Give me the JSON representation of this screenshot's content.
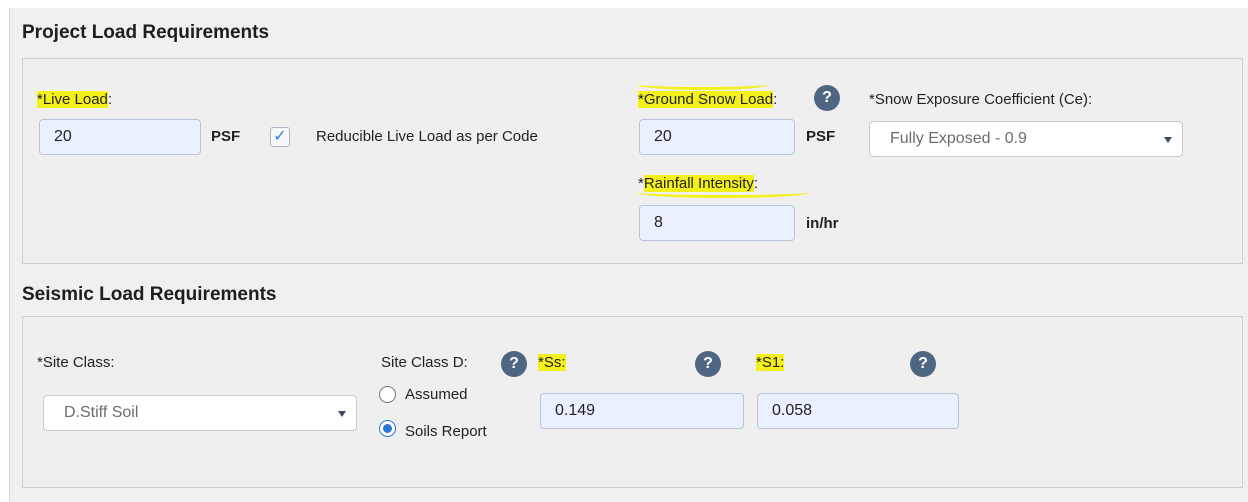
{
  "project": {
    "title": "Project Load Requirements",
    "live_load": {
      "label_prefix": "*",
      "label_hl": "Live Load",
      "label_suffix": ":",
      "value": "20",
      "unit": "PSF"
    },
    "reducible": {
      "label": "Reducible Live Load as per Code",
      "checked": true,
      "check_glyph": "✓"
    },
    "ground_snow": {
      "label_hl": "*Ground Snow Load",
      "label_suffix": ":",
      "value": "20",
      "unit": "PSF",
      "help": "?"
    },
    "snow_exposure": {
      "label": "*Snow Exposure Coefficient (Ce):",
      "selected": "Fully Exposed - 0.9"
    },
    "rainfall": {
      "label_prefix": "*",
      "label_hl": "Rainfall Intensity",
      "label_suffix": ":",
      "value": "8",
      "unit": "in/hr"
    }
  },
  "seismic": {
    "title": "Seismic Load Requirements",
    "site_class": {
      "label": "*Site Class:",
      "selected": "D.Stiff Soil"
    },
    "site_class_d": {
      "label": "Site Class D:",
      "help": "?",
      "options": [
        {
          "label": "Assumed",
          "selected": false
        },
        {
          "label": "Soils Report",
          "selected": true
        }
      ]
    },
    "ss": {
      "label": "*Ss:",
      "value": "0.149",
      "help": "?"
    },
    "s1": {
      "label": "*S1:",
      "value": "0.058",
      "help": "?"
    }
  },
  "colors": {
    "highlight": "#f4f01c",
    "input_bg": "#eaf0ff",
    "help_bg": "#4f6682",
    "accent": "#2b75d6"
  }
}
